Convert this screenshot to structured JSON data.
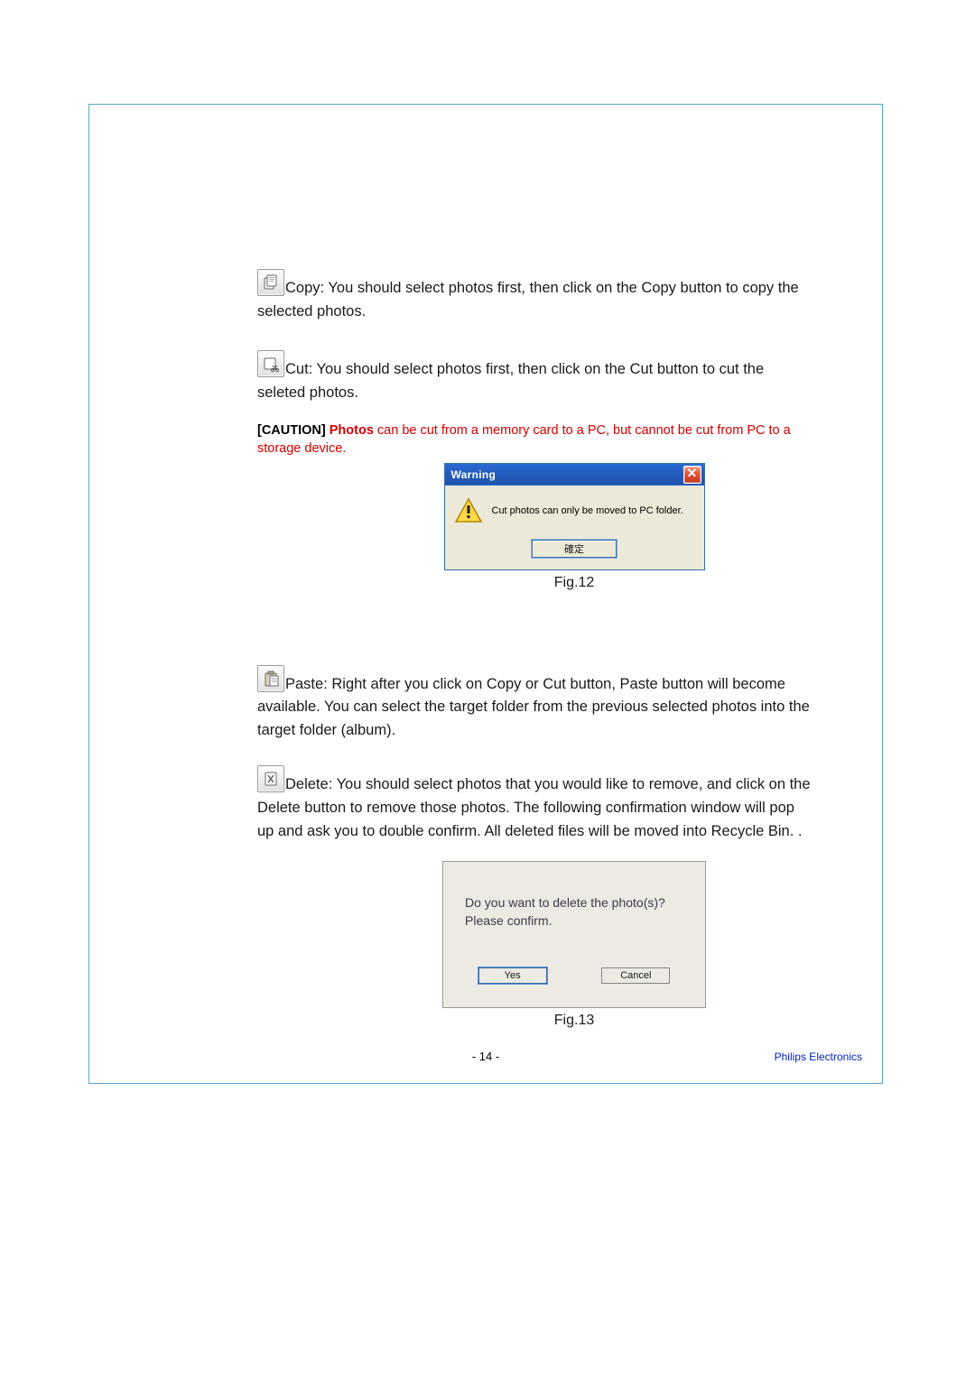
{
  "copy": {
    "label": "Copy:",
    "text1": " You should select photos first, then click on the Copy button to copy the ",
    "text2": "selected photos."
  },
  "cut": {
    "label": "Cut:",
    "text1": " You should select photos first, then click on the Cut button to cut the ",
    "text2": "seleted photos."
  },
  "caution": {
    "tag": "[CAUTION]",
    "lead": " Photos",
    "rest1": " can be cut from a memory card to a PC, but cannot be cut from PC to a ",
    "rest2": "storage device."
  },
  "fig12": {
    "title": "Warning",
    "close_x": "✕",
    "msg": "Cut photos can only be moved to PC folder.",
    "ok": "確定",
    "caption": "Fig.12"
  },
  "paste": {
    "label": "Paste:",
    "text1": " Right after you click on Copy or Cut button, Paste button will become ",
    "text2": "available. You can select the target folder from the previous selected photos into the ",
    "text3": "target folder (album)."
  },
  "delete": {
    "label": "Delete:",
    "text1": " You should select photos that you would like to remove, and click on the ",
    "text2": "Delete button to remove those photos. The following confirmation window will pop ",
    "text3": "up and ask you to double confirm. All deleted files will be moved into Recycle Bin. ."
  },
  "fig13": {
    "line1": "Do you want to delete the photo(s)?",
    "line2": "Please confirm.",
    "yes": "Yes",
    "cancel": "Cancel",
    "caption": "Fig.13"
  },
  "footer": {
    "page": "- 14 -",
    "brand": "Philips Electronics"
  }
}
